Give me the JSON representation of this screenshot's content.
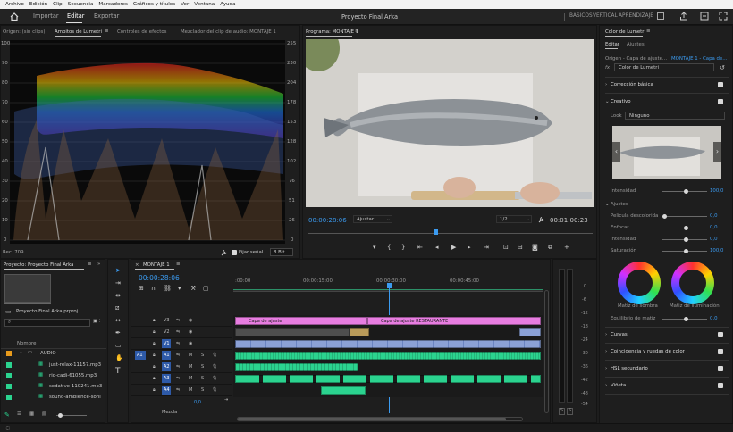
{
  "menu": [
    "Archivo",
    "Edición",
    "Clip",
    "Secuencia",
    "Marcadores",
    "Gráficos y títulos",
    "Ver",
    "Ventana",
    "Ayuda"
  ],
  "app": {
    "tabs": [
      "Importar",
      "Editar",
      "Exportar"
    ],
    "active_tab": "Editar",
    "title": "Proyecto Final Arka",
    "workspaces": [
      "BÁSICOS",
      "VERTICAL",
      "APRENDIZAJE"
    ]
  },
  "scopes": {
    "tab_source": "Origen: (sin clips)",
    "tab_lumetri": "Ámbitos de Lumetri",
    "tab_effects": "Controles de efectos",
    "tab_mixer": "Mezclador del clip de audio: MONTAJE 1",
    "left_scale": [
      "100",
      "90",
      "80",
      "70",
      "60",
      "50",
      "40",
      "30",
      "20",
      "10",
      "0"
    ],
    "right_scale": [
      "255",
      "230",
      "204",
      "178",
      "153",
      "128",
      "102",
      "76",
      "51",
      "26",
      "0"
    ],
    "footer_label": "Rec. 709",
    "clamp_label": "Fijar señal",
    "bit_depth": "8 Bit"
  },
  "program": {
    "title": "Programa: MONTAJE 1",
    "timecode": "00:00:28:06",
    "fit": "Ajustar",
    "resolution": "1/2",
    "duration": "00:01:00:23"
  },
  "project": {
    "title": "Proyecto: Proyecto Final Arka",
    "file": "Proyecto Final Arka.prproj",
    "column": "Nombre",
    "folder": "AUDIO",
    "files": [
      "just-relax-11157.mp3",
      "rio-cadi-61055.mp3",
      "sedative-110241.mp3",
      "sound-ambience-soni"
    ]
  },
  "timeline": {
    "title": "MONTAJE 1",
    "timecode": "00:00:28:06",
    "ruler": [
      ":00:00",
      "00:00:15:00",
      "00:00:30:00",
      "00:00:45:00"
    ],
    "video_tracks": [
      "V3",
      "V2",
      "V1"
    ],
    "audio_tracks": [
      "A1",
      "A2",
      "A3",
      "A4"
    ],
    "source_patch": "A1",
    "track_btns": [
      "M",
      "S"
    ],
    "mix_label": "Mezcla",
    "mix_value": "0,0",
    "clip_v3": "Capa de ajuste",
    "clip_v3b": "Capa de ajuste RESTAURANTE"
  },
  "meters": {
    "scale": [
      "0",
      "-6",
      "-12",
      "-18",
      "-24",
      "-30",
      "-36",
      "-42",
      "-48",
      "-54"
    ],
    "solo": [
      "S",
      "S"
    ]
  },
  "lumetri": {
    "panel_title": "Color de Lumetri",
    "tabs": [
      "Editar",
      "Ajustes"
    ],
    "source": "Origen - Capa de ajuste...",
    "target": "MONTAJE 1 - Capa de...",
    "fx": "fx",
    "fx_name": "Color de Lumetri",
    "basic": "Corrección básica",
    "creative": "Creativo",
    "look_label": "Look",
    "look_value": "Ninguno",
    "intensity_label": "Intensidad",
    "intensity_value": "100,0",
    "adjust_label": "Ajustes",
    "faded_label": "Película descolorida",
    "faded_value": "0,0",
    "sharpen_label": "Enfocar",
    "sharpen_value": "0,0",
    "vibrance_label": "Intensidad",
    "vibrance_value": "0,0",
    "saturation_label": "Saturación",
    "saturation_value": "100,0",
    "shadow_label": "Matiz de sombra",
    "highlight_label": "Matiz de iluminación",
    "balance_label": "Equilibrio de matiz",
    "balance_value": "0,0",
    "curves": "Curvas",
    "wheels": "Coincidencia y ruedas de color",
    "hsl": "HSL secundario",
    "vignette": "Viñeta"
  }
}
